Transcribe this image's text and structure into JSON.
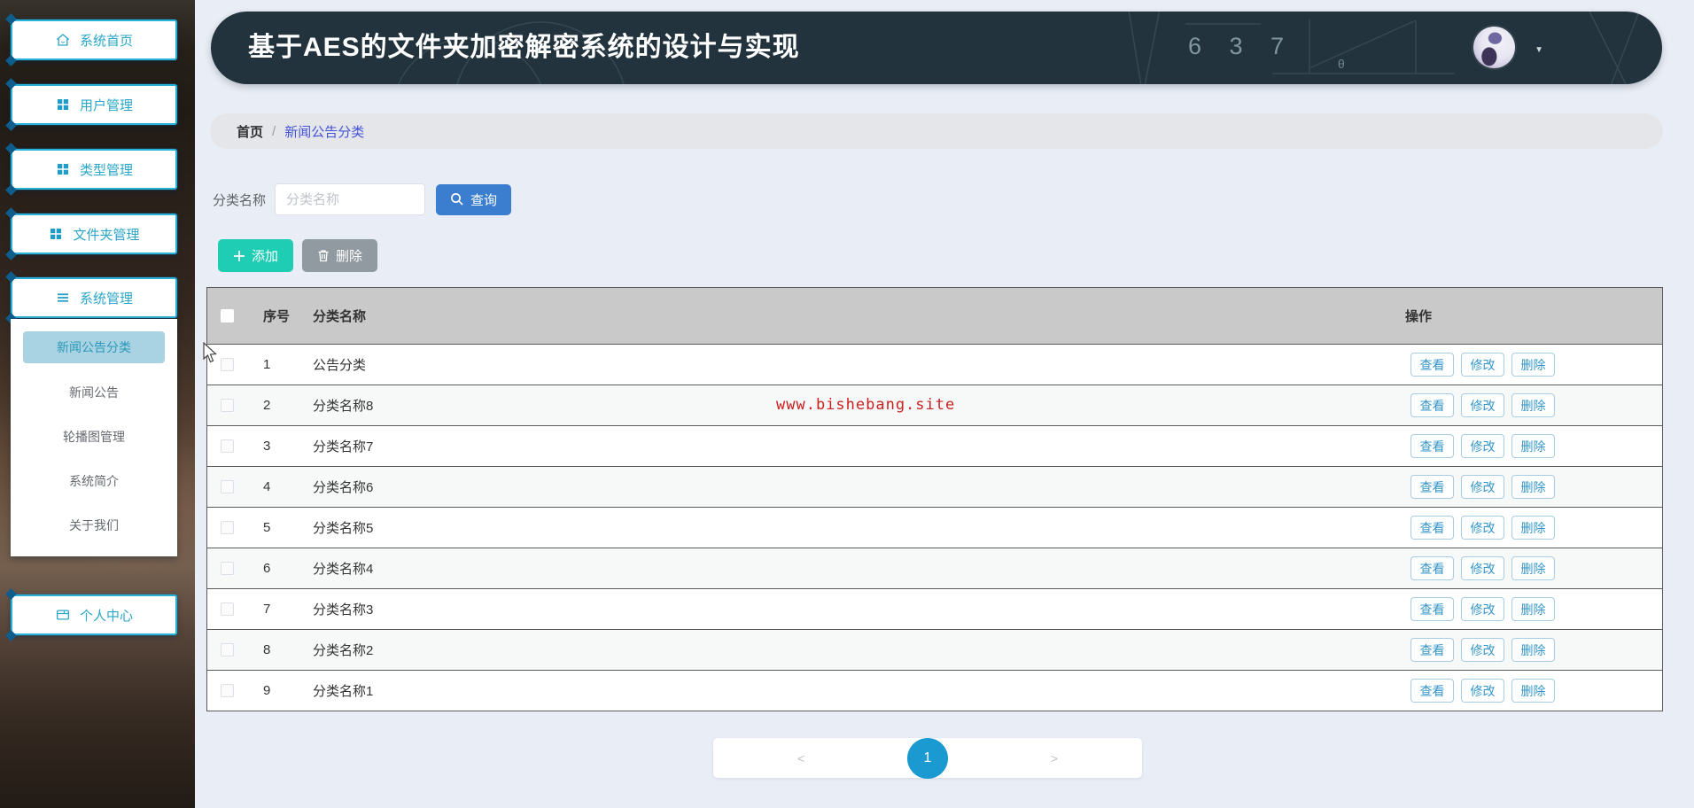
{
  "app": {
    "title": "基于AES的文件夹加密解密系统的设计与实现"
  },
  "header": {
    "chalk_numbers": "6 3 7",
    "chalk_theta": "θ",
    "dropdown_icon": "▼"
  },
  "sidebar": {
    "items": [
      {
        "label": "系统首页",
        "icon": "home-icon"
      },
      {
        "label": "用户管理",
        "icon": "grid-icon"
      },
      {
        "label": "类型管理",
        "icon": "grid-icon"
      },
      {
        "label": "文件夹管理",
        "icon": "grid-icon"
      },
      {
        "label": "系统管理",
        "icon": "list-icon"
      }
    ],
    "submenu": [
      {
        "label": "新闻公告分类",
        "active": true
      },
      {
        "label": "新闻公告",
        "active": false
      },
      {
        "label": "轮播图管理",
        "active": false
      },
      {
        "label": "系统简介",
        "active": false
      },
      {
        "label": "关于我们",
        "active": false
      }
    ],
    "personal": {
      "label": "个人中心",
      "icon": "card-icon"
    }
  },
  "breadcrumb": {
    "home": "首页",
    "separator": "/",
    "current": "新闻公告分类"
  },
  "search": {
    "label": "分类名称",
    "placeholder": "分类名称",
    "value": "",
    "button_label": "查询"
  },
  "toolbar": {
    "add_label": "添加",
    "delete_label": "删除"
  },
  "table": {
    "headers": {
      "index": "序号",
      "name": "分类名称",
      "actions": "操作"
    },
    "row_actions": [
      "查看",
      "修改",
      "删除"
    ],
    "rows": [
      {
        "index": "1",
        "name": "公告分类"
      },
      {
        "index": "2",
        "name": "分类名称8"
      },
      {
        "index": "3",
        "name": "分类名称7"
      },
      {
        "index": "4",
        "name": "分类名称6"
      },
      {
        "index": "5",
        "name": "分类名称5"
      },
      {
        "index": "6",
        "name": "分类名称4"
      },
      {
        "index": "7",
        "name": "分类名称3"
      },
      {
        "index": "8",
        "name": "分类名称2"
      },
      {
        "index": "9",
        "name": "分类名称1"
      }
    ]
  },
  "watermark": {
    "text": "www.bishebang.site"
  },
  "pagination": {
    "prev": "<",
    "page": "1",
    "next": ">"
  },
  "colors": {
    "header_bg": "#22333e",
    "accent_cyan": "#29b3da",
    "sidebar_text": "#2aa6c6",
    "query_button": "#3b7ecf",
    "add_button": "#1fcdb4",
    "delete_button": "#909aa0",
    "action_text": "#3496c8",
    "pagination_active": "#1b9ad2",
    "watermark_red": "#cb2020",
    "breadcrumb_active": "#4553d8"
  }
}
